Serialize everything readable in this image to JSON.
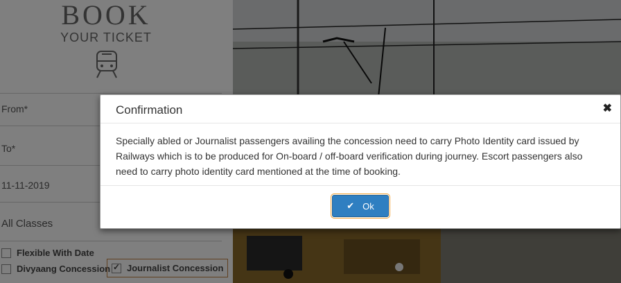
{
  "brand": {
    "title": "BOOK",
    "subtitle": "YOUR TICKET",
    "icon": "train-icon"
  },
  "form": {
    "from_label": "From*",
    "to_label": "To*",
    "date_value": "11-11-2019",
    "class_value": "All Classes"
  },
  "options": {
    "flexible_label": "Flexible With Date",
    "divyaang_label": "Divyaang Concession",
    "journalist_label": "Journalist Concession",
    "journalist_checked": true
  },
  "dialog": {
    "title": "Confirmation",
    "close_symbol": "✖",
    "message": "Specially abled or Journalist passengers availing the concession need to carry Photo Identity card issued by Railways which is to be produced for On-board / off-board verification during journey. Escort passengers also need to carry photo identity card mentioned at the time of booking.",
    "ok_label": "Ok",
    "ok_icon": "check-icon"
  },
  "colors": {
    "primary": "#2f7fc1",
    "focus_ring": "#f0a030"
  }
}
